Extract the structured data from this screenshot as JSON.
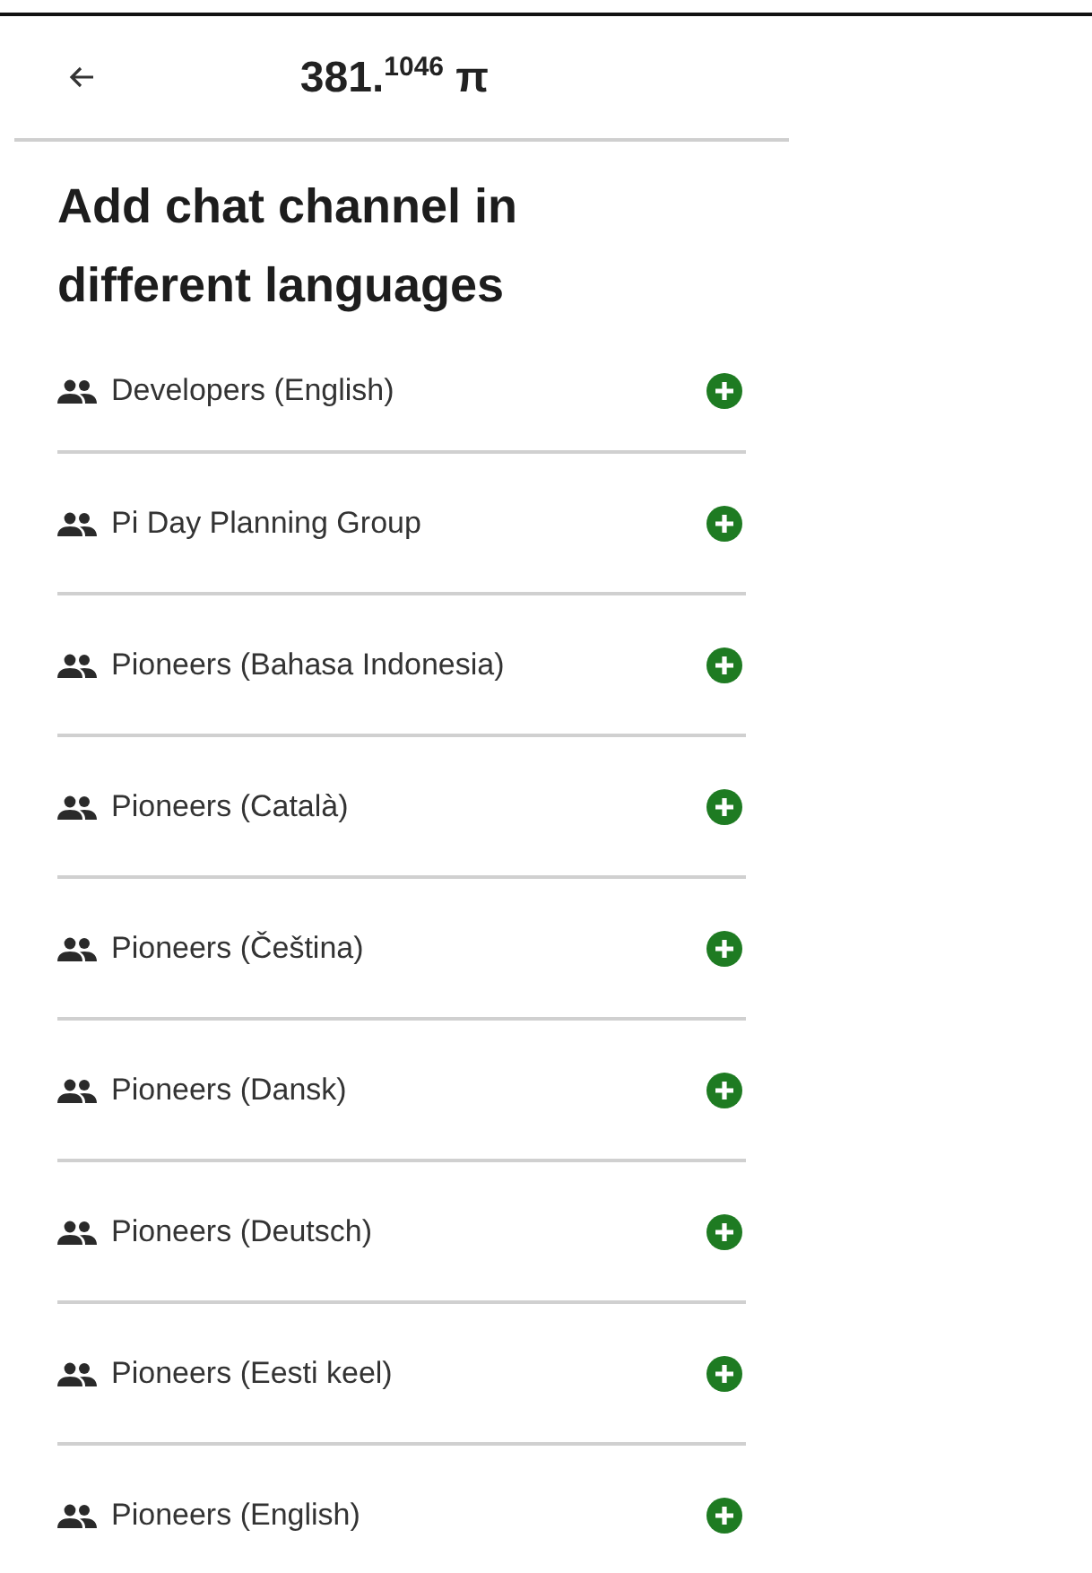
{
  "header": {
    "title": "381.$^{1046}$ π"
  },
  "heading": "Add chat channel in different languages",
  "channels": [
    {
      "name": "Developers (English)"
    },
    {
      "name": "Pi Day Planning Group"
    },
    {
      "name": "Pioneers (Bahasa Indonesia)"
    },
    {
      "name": "Pioneers (Català)"
    },
    {
      "name": "Pioneers (Čeština)"
    },
    {
      "name": "Pioneers (Dansk)"
    },
    {
      "name": "Pioneers (Deutsch)"
    },
    {
      "name": "Pioneers (Eesti keel)"
    },
    {
      "name": "Pioneers (English)"
    }
  ]
}
